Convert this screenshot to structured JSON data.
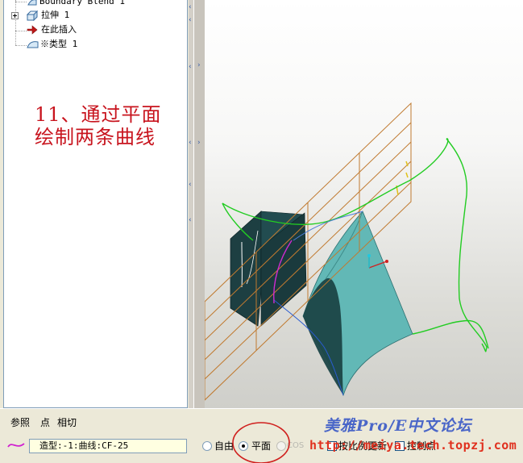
{
  "model_tree": {
    "items": [
      {
        "label": "Boundary Blend 1",
        "icon": "boundary-blend-icon"
      },
      {
        "label": "拉伸 1",
        "icon": "extrude-icon"
      },
      {
        "label": "在此插入",
        "icon": "insert-here-arrow-icon"
      },
      {
        "label": "※类型 1",
        "icon": "style-feature-icon"
      }
    ]
  },
  "annotation": {
    "text": "11、通过平面绘制两条曲线"
  },
  "dashboard": {
    "tabs": [
      "参照",
      "点",
      "相切"
    ],
    "curve_field_value": "造型:-1:曲线:CF-25",
    "radio_options": [
      {
        "label": "自由",
        "selected": false,
        "enabled": true
      },
      {
        "label": "平面",
        "selected": true,
        "enabled": true
      },
      {
        "label": "COS",
        "selected": false,
        "enabled": false
      }
    ],
    "checkboxes": [
      {
        "label": "按比例更新",
        "checked": false
      },
      {
        "label": "控制点",
        "checked": false
      }
    ]
  },
  "watermark": {
    "title": "美雅Pro/E中文论坛",
    "url": "http://meiya.tech.topzj.com"
  },
  "colors": {
    "annotation_red": "#c8141e",
    "curve_green": "#22cc22",
    "plane_orange": "#c07a30",
    "surface_teal": "#5fb8b8",
    "solid_dark": "#1a3b3e",
    "highlight_circle": "#d0201e",
    "watermark_blue": "#4a66c8",
    "watermark_red": "#e0301e"
  }
}
